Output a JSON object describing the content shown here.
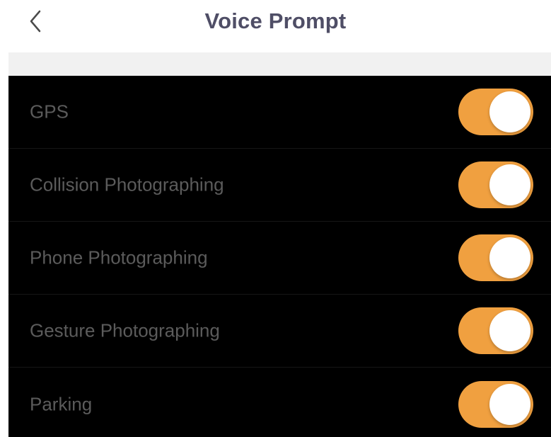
{
  "header": {
    "title": "Voice Prompt",
    "back_icon": "chevron-left-icon"
  },
  "colors": {
    "accent": "#f0a040",
    "title": "#4f4e66",
    "list_background": "#000000",
    "label": "#5b5b5b"
  },
  "settings": [
    {
      "label": "GPS",
      "enabled": true
    },
    {
      "label": "Collision Photographing",
      "enabled": true
    },
    {
      "label": "Phone Photographing",
      "enabled": true
    },
    {
      "label": "Gesture Photographing",
      "enabled": true
    },
    {
      "label": "Parking",
      "enabled": true
    }
  ]
}
